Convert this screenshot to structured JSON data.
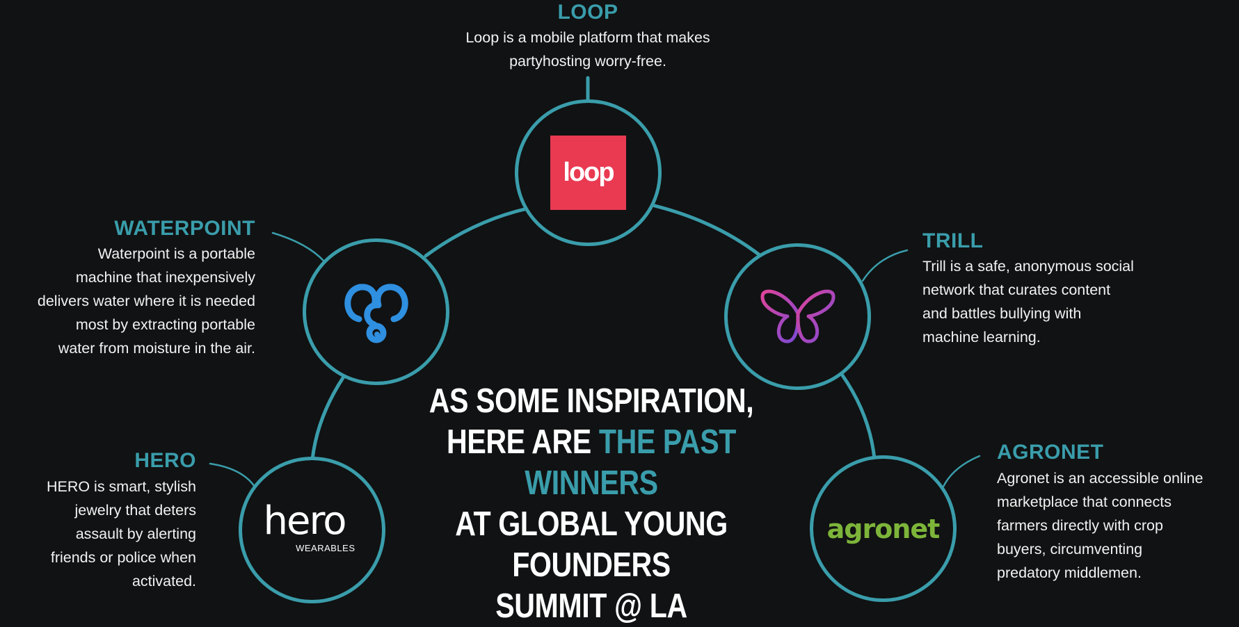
{
  "headline": {
    "line1": "AS SOME INSPIRATION,",
    "line2_prefix": "HERE ARE ",
    "line2_highlight": "THE PAST WINNERS",
    "line3": "AT GLOBAL YOUNG FOUNDERS",
    "line4": "SUMMIT @ LA"
  },
  "colors": {
    "accent": "#3a9dab",
    "background": "#111213",
    "loop_brand": "#e93a52",
    "agronet_brand": "#7db53a"
  },
  "winners": {
    "loop": {
      "name": "LOOP",
      "description_line1": "Loop is a mobile platform that makes",
      "description_line2": "partyhosting worry-free.",
      "logo_text": "loop",
      "icon": "loop-logo"
    },
    "waterpoint": {
      "name": "WATERPOINT",
      "description_lines": [
        "Waterpoint is a portable",
        "machine that inexpensively",
        "delivers water where it is needed",
        "most by extracting portable",
        "water from moisture in the air."
      ],
      "icon": "water-drop-logo"
    },
    "trill": {
      "name": "TRILL",
      "description_lines": [
        "Trill is a safe, anonymous social",
        "network that curates content",
        "and battles bullying with",
        "machine learning."
      ],
      "icon": "butterfly-logo"
    },
    "hero": {
      "name": "HERO",
      "description_lines": [
        "HERO is smart, stylish",
        "jewelry that deters",
        "assault by alerting",
        "friends or police when",
        "activated."
      ],
      "logo_text": "hero",
      "logo_sub": "WEARABLES",
      "icon": "hero-logo"
    },
    "agronet": {
      "name": "AGRONET",
      "description_lines": [
        "Agronet is an accessible online",
        "marketplace that connects",
        "farmers directly with crop",
        "buyers, circumventing",
        "predatory middlemen."
      ],
      "logo_text": "agronet",
      "icon": "agronet-logo"
    }
  }
}
